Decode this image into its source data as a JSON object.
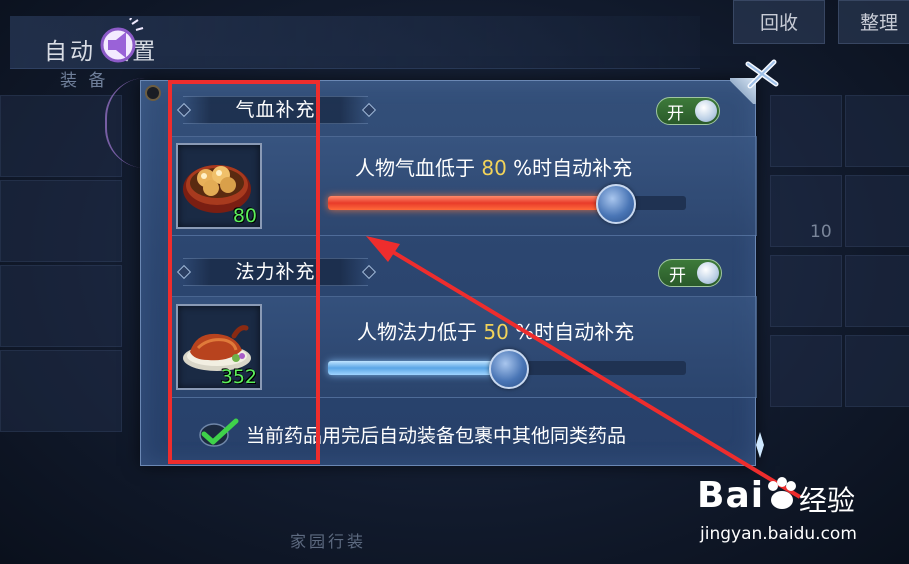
{
  "background": {
    "title": "自动   设置",
    "subtitle": "装 备",
    "buttons": [
      "回收",
      "整理"
    ],
    "slot_number": "10",
    "bottom_text": "家园行装"
  },
  "panel": {
    "hp_section": {
      "title": "气血补充",
      "toggle_label": "开",
      "item_count": "80",
      "threshold_prefix": "人物气血低于 ",
      "threshold_value": "80",
      "threshold_suffix": " %时自动补充",
      "slider_fraction": 0.8
    },
    "mp_section": {
      "title": "法力补充",
      "toggle_label": "开",
      "item_count": "352",
      "threshold_prefix": "人物法力低于 ",
      "threshold_value": "50",
      "threshold_suffix": " %时自动补充",
      "slider_fraction": 0.5
    },
    "footer_text": "当前药品用完后自动装备包裹中其他同类药品"
  },
  "watermark": {
    "brand": "Bai",
    "brand_suffix": "经验",
    "url": "jingyan.baidu.com"
  },
  "colors": {
    "accent_yellow": "#f2d35a",
    "count_green": "#5cf05c",
    "annotation_red": "#ee2d2d",
    "toggle_green": "#3d7a3a"
  },
  "icons": [
    "speaker-icon",
    "close-icon",
    "check-icon",
    "food-dumplings-icon",
    "food-roast-duck-icon",
    "paw-icon"
  ]
}
